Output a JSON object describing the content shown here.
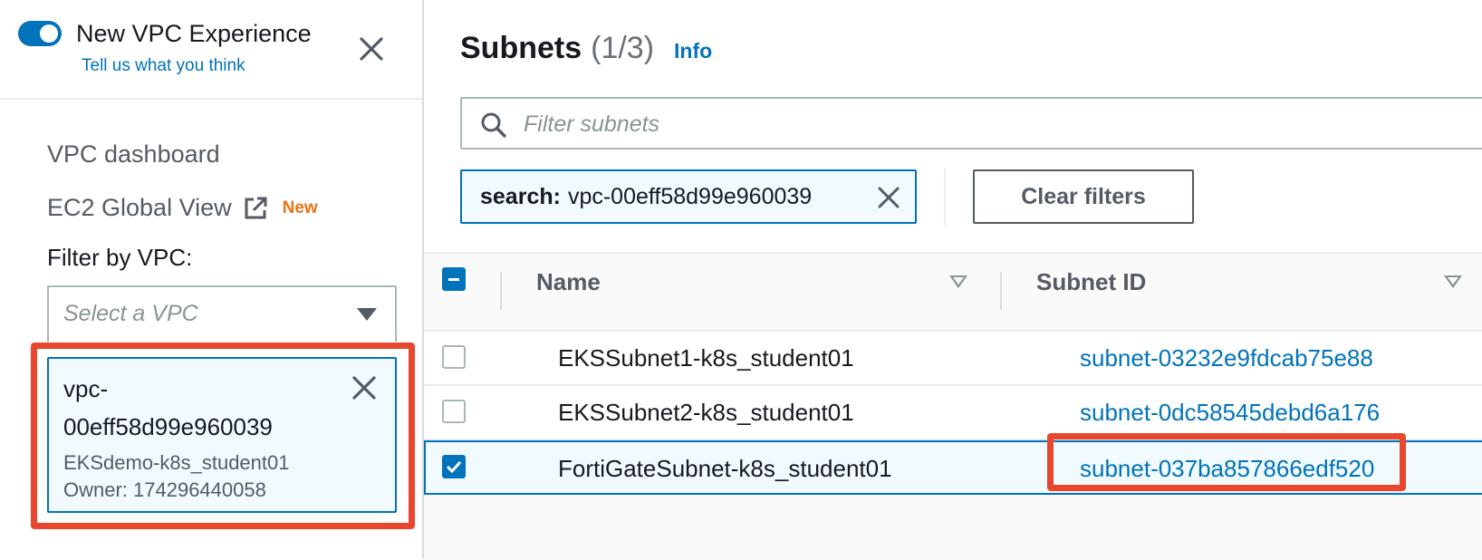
{
  "sidebar": {
    "experience_title": "New VPC Experience",
    "experience_link": "Tell us what you think",
    "nav": {
      "dashboard": "VPC dashboard",
      "global_view": "EC2 Global View",
      "new_badge": "New"
    },
    "filter_label": "Filter by VPC:",
    "select_placeholder": "Select a VPC",
    "selected_vpc": {
      "id_line1": "vpc-",
      "id_line2": "00eff58d99e960039",
      "name": "EKSdemo-k8s_student01",
      "owner": "Owner: 174296440058"
    }
  },
  "main": {
    "title": "Subnets",
    "count": "(1/3)",
    "info": "Info",
    "search_placeholder": "Filter subnets",
    "filter_chip": {
      "key": "search:",
      "value": "vpc-00eff58d99e960039"
    },
    "clear_filters": "Clear filters",
    "columns": [
      "Name",
      "Subnet ID"
    ],
    "rows": [
      {
        "name": "EKSSubnet1-k8s_student01",
        "subnet_id": "subnet-03232e9fdcab75e88",
        "selected": false
      },
      {
        "name": "EKSSubnet2-k8s_student01",
        "subnet_id": "subnet-0dc58545debd6a176",
        "selected": false
      },
      {
        "name": "FortiGateSubnet-k8s_student01",
        "subnet_id": "subnet-037ba857866edf520",
        "selected": true
      }
    ]
  },
  "colors": {
    "accent": "#0073bb",
    "highlight": "#e8472e",
    "new_badge": "#ec7211"
  },
  "icons": [
    "toggle-switch",
    "close-icon",
    "external-link-icon",
    "dropdown-caret-icon",
    "search-icon",
    "sort-icon"
  ]
}
